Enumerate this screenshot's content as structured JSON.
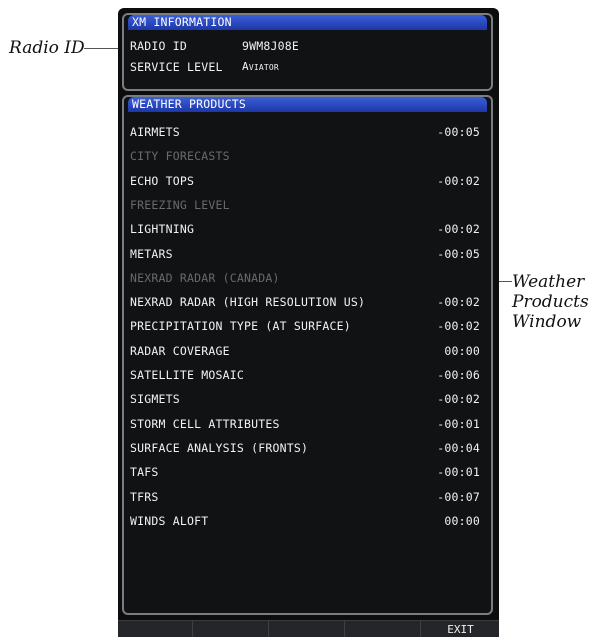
{
  "callouts": {
    "radio_id": "Radio ID",
    "weather_line1": "Weather",
    "weather_line2": "Products",
    "weather_line3": "Window"
  },
  "xm_info": {
    "header": "XM INFORMATION",
    "radio_id_label": "RADIO ID",
    "radio_id_value": "9WM8J08E",
    "service_level_label": "SERVICE LEVEL",
    "service_level_value": "Aviator"
  },
  "weather": {
    "header": "WEATHER PRODUCTS",
    "items": [
      {
        "name": "AIRMETS",
        "time": "-00:05"
      },
      {
        "name": "CITY FORECASTS",
        "time": ""
      },
      {
        "name": "ECHO TOPS",
        "time": "-00:02"
      },
      {
        "name": "FREEZING LEVEL",
        "time": ""
      },
      {
        "name": "LIGHTNING",
        "time": "-00:02"
      },
      {
        "name": "METARS",
        "time": "-00:05"
      },
      {
        "name": "NEXRAD RADAR (CANADA)",
        "time": ""
      },
      {
        "name": "NEXRAD RADAR (HIGH RESOLUTION US)",
        "time": "-00:02"
      },
      {
        "name": "PRECIPITATION TYPE (AT SURFACE)",
        "time": "-00:02"
      },
      {
        "name": "RADAR COVERAGE",
        "time": "00:00"
      },
      {
        "name": "SATELLITE MOSAIC",
        "time": "-00:06"
      },
      {
        "name": "SIGMETS",
        "time": "-00:02"
      },
      {
        "name": "STORM CELL ATTRIBUTES",
        "time": "-00:01"
      },
      {
        "name": "SURFACE ANALYSIS (FRONTS)",
        "time": "-00:04"
      },
      {
        "name": "TAFS",
        "time": "-00:01"
      },
      {
        "name": "TFRS",
        "time": "-00:07"
      },
      {
        "name": "WINDS ALOFT",
        "time": "00:00"
      }
    ]
  },
  "softkeys": {
    "exit_label": "EXIT"
  }
}
